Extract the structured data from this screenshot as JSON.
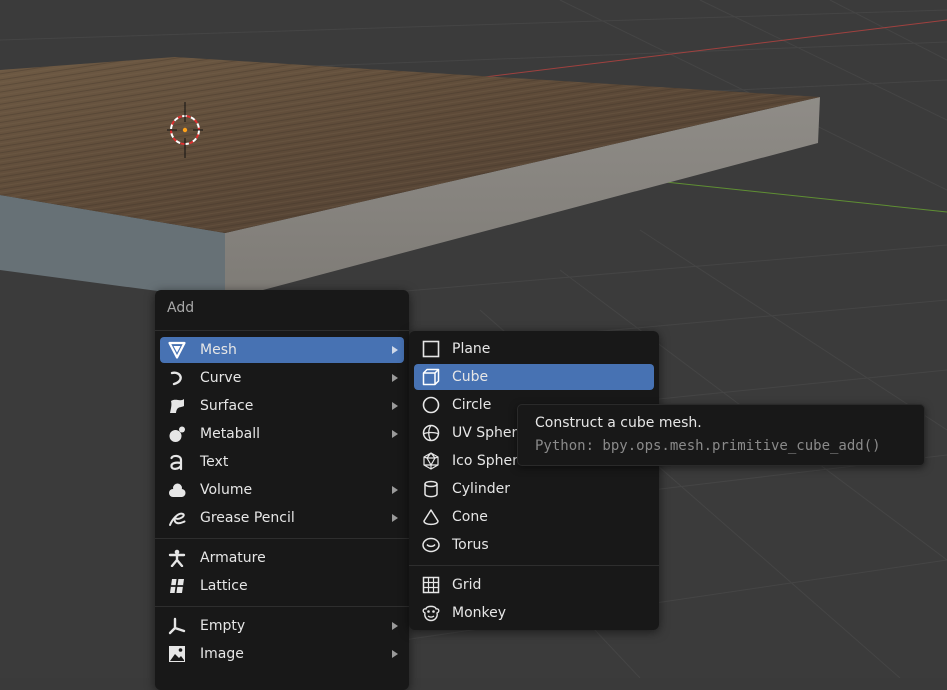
{
  "add_menu": {
    "title": "Add",
    "groups": [
      [
        {
          "label": "Mesh",
          "icon": "mesh-icon",
          "submenu": true,
          "highlighted": true
        },
        {
          "label": "Curve",
          "icon": "curve-icon",
          "submenu": true
        },
        {
          "label": "Surface",
          "icon": "surface-icon",
          "submenu": true
        },
        {
          "label": "Metaball",
          "icon": "metaball-icon",
          "submenu": true
        },
        {
          "label": "Text",
          "icon": "text-icon",
          "submenu": false
        },
        {
          "label": "Volume",
          "icon": "volume-icon",
          "submenu": true
        },
        {
          "label": "Grease Pencil",
          "icon": "grease-pencil-icon",
          "submenu": true
        }
      ],
      [
        {
          "label": "Armature",
          "icon": "armature-icon",
          "submenu": false
        },
        {
          "label": "Lattice",
          "icon": "lattice-icon",
          "submenu": false
        }
      ],
      [
        {
          "label": "Empty",
          "icon": "empty-icon",
          "submenu": true
        },
        {
          "label": "Image",
          "icon": "image-icon",
          "submenu": true
        }
      ]
    ]
  },
  "mesh_menu": {
    "groups": [
      [
        {
          "label": "Plane",
          "icon": "plane-icon"
        },
        {
          "label": "Cube",
          "icon": "cube-icon",
          "highlighted": true
        },
        {
          "label": "Circle",
          "icon": "circle-icon"
        },
        {
          "label": "UV Sphere",
          "icon": "uv-sphere-icon"
        },
        {
          "label": "Ico Sphere",
          "icon": "ico-sphere-icon"
        },
        {
          "label": "Cylinder",
          "icon": "cylinder-icon"
        },
        {
          "label": "Cone",
          "icon": "cone-icon"
        },
        {
          "label": "Torus",
          "icon": "torus-icon"
        }
      ],
      [
        {
          "label": "Grid",
          "icon": "grid-icon"
        },
        {
          "label": "Monkey",
          "icon": "monkey-icon"
        }
      ]
    ]
  },
  "tooltip": {
    "description": "Construct a cube mesh.",
    "python": "Python: bpy.ops.mesh.primitive_cube_add()"
  },
  "colors": {
    "highlight": "#4772b3",
    "menu_bg": "#181818",
    "viewport_bg": "#3a3a3a",
    "x_axis": "#a0413f",
    "y_axis": "#5f8f33"
  }
}
